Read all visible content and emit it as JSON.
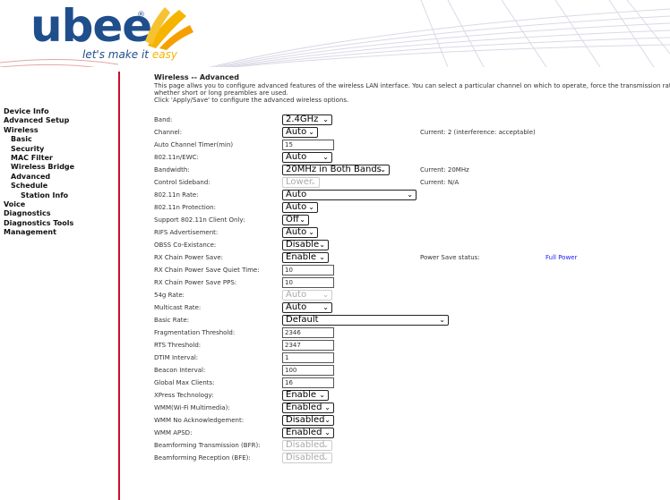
{
  "brand": {
    "logo": "ubee",
    "tagline_main": "let's make it",
    "tagline_accent": "easy"
  },
  "nav": [
    {
      "label": "Device Info",
      "level": 0
    },
    {
      "label": "Advanced Setup",
      "level": 0
    },
    {
      "label": "Wireless",
      "level": 0
    },
    {
      "label": "Basic",
      "level": 1
    },
    {
      "label": "Security",
      "level": 1
    },
    {
      "label": "MAC Filter",
      "level": 1
    },
    {
      "label": "Wireless Bridge",
      "level": 1
    },
    {
      "label": "Advanced",
      "level": 1
    },
    {
      "label": "Schedule",
      "level": 1
    },
    {
      "label": "Station Info",
      "level": 2
    },
    {
      "label": "Voice",
      "level": 0
    },
    {
      "label": "Diagnostics",
      "level": 0
    },
    {
      "label": "Diagnostics Tools",
      "level": 0
    },
    {
      "label": "Management",
      "level": 0
    }
  ],
  "page": {
    "title": "Wireless -- Advanced",
    "desc1": "This page allws you to configure advanced features of the wireless LAN interface. You can select a particular channel on which to operate, force the transmission rate t",
    "desc2": "whether short or long preambles are used.",
    "desc3": "Click 'Apply/Save' to configure the advanced wireless options."
  },
  "fields": [
    {
      "label": "Band:",
      "type": "select",
      "value": "2.4GHz"
    },
    {
      "label": "Channel:",
      "type": "select",
      "value": "Auto",
      "note": "Current: 2 (interference: acceptable)"
    },
    {
      "label": "Auto Channel Timer(min)",
      "type": "text",
      "value": "15"
    },
    {
      "label": "802.11n/EWC:",
      "type": "select",
      "value": "Auto"
    },
    {
      "label": "Bandwidth:",
      "type": "select",
      "value": "20MHz in Both Bands",
      "note": "Current: 20MHz"
    },
    {
      "label": "Control Sideband:",
      "type": "select",
      "value": "Lower",
      "disabled": true,
      "note": "Current: N/A"
    },
    {
      "label": "802.11n Rate:",
      "type": "select",
      "value": "Auto"
    },
    {
      "label": "802.11n Protection:",
      "type": "select",
      "value": "Auto"
    },
    {
      "label": "Support 802.11n Client Only:",
      "type": "select",
      "value": "Off"
    },
    {
      "label": "RIFS Advertisement:",
      "type": "select",
      "value": "Auto"
    },
    {
      "label": "OBSS Co-Existance:",
      "type": "select",
      "value": "Disable"
    },
    {
      "label": "RX Chain Power Save:",
      "type": "select",
      "value": "Enable",
      "note": "Power Save status:",
      "note2": "Full Power"
    },
    {
      "label": "RX Chain Power Save Quiet Time:",
      "type": "text",
      "value": "10"
    },
    {
      "label": "RX Chain Power Save PPS:",
      "type": "text",
      "value": "10"
    },
    {
      "label": "54g Rate:",
      "type": "select",
      "value": "Auto",
      "disabled": true
    },
    {
      "label": "Multicast Rate:",
      "type": "select",
      "value": "Auto"
    },
    {
      "label": "Basic Rate:",
      "type": "select",
      "value": "Default"
    },
    {
      "label": "Fragmentation Threshold:",
      "type": "text",
      "value": "2346"
    },
    {
      "label": "RTS Threshold:",
      "type": "text",
      "value": "2347"
    },
    {
      "label": "DTIM Interval:",
      "type": "text",
      "value": "1"
    },
    {
      "label": "Beacon Interval:",
      "type": "text",
      "value": "100"
    },
    {
      "label": "Global Max Clients:",
      "type": "text",
      "value": "16"
    },
    {
      "label": "XPress Technology:",
      "type": "select",
      "value": "Enable"
    },
    {
      "label": "WMM(Wi-Fi Multimedia):",
      "type": "select",
      "value": "Enabled"
    },
    {
      "label": "WMM No Acknowledgement:",
      "type": "select",
      "value": "Disabled"
    },
    {
      "label": "WMM APSD:",
      "type": "select",
      "value": "Enabled"
    },
    {
      "label": "Beamforming Transmission (BFR):",
      "type": "select",
      "value": "Disabled",
      "disabled": true
    },
    {
      "label": "Beamforming Reception (BFE):",
      "type": "select",
      "value": "Disabled",
      "disabled": true
    }
  ]
}
